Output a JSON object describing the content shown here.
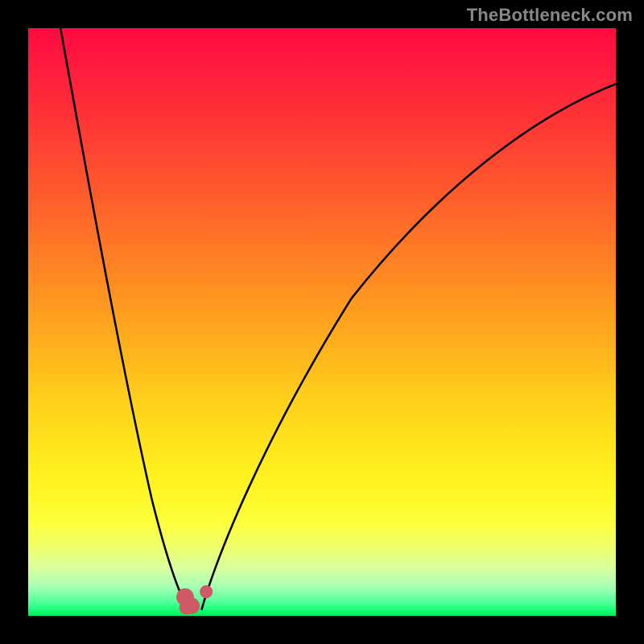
{
  "watermark": "TheBottleneck.com",
  "colors": {
    "frame": "#000000",
    "curve": "#000000",
    "marker": "#cf5a66",
    "gradient_top": "#ff0a3e",
    "gradient_bottom": "#00ef5e"
  },
  "chart_data": {
    "type": "line",
    "title": "",
    "xlabel": "",
    "ylabel": "",
    "xlim": [
      0,
      100
    ],
    "ylim": [
      0,
      100
    ],
    "note": "Coordinates use (0,0) at top-left of the gradient panel, (100,100) at bottom-right. The two black curves form a V; the small pink cluster marks the optimum at the V's bottom.",
    "series": [
      {
        "name": "left-curve",
        "x": [
          5.5,
          6.8,
          8.5,
          10.5,
          12.5,
          14.5,
          16.5,
          18.5,
          20.5,
          22.5,
          24.0,
          25.2,
          26.0,
          26.6,
          27.0,
          27.3,
          27.5
        ],
        "y": [
          0.0,
          10.0,
          22.0,
          35.0,
          47.0,
          57.5,
          66.5,
          74.0,
          80.5,
          85.5,
          89.5,
          92.5,
          95.0,
          96.8,
          98.0,
          98.8,
          99.2
        ]
      },
      {
        "name": "right-curve",
        "x": [
          29.5,
          30.5,
          32.5,
          35.5,
          39.5,
          44.5,
          50.5,
          57.5,
          65.5,
          74.0,
          83.0,
          92.0,
          100.0
        ],
        "y": [
          99.0,
          95.5,
          89.0,
          80.5,
          70.5,
          60.5,
          50.5,
          41.5,
          33.0,
          25.5,
          19.0,
          13.5,
          9.5
        ]
      }
    ],
    "markers": [
      {
        "name": "optimum-left",
        "x": 26.7,
        "y": 96.8,
        "r": 1.5
      },
      {
        "name": "optimum-mid",
        "x": 27.8,
        "y": 98.3,
        "r": 1.4
      },
      {
        "name": "optimum-low",
        "x": 26.9,
        "y": 98.6,
        "r": 1.2
      },
      {
        "name": "optimum-right",
        "x": 30.3,
        "y": 95.9,
        "r": 1.1
      }
    ]
  }
}
